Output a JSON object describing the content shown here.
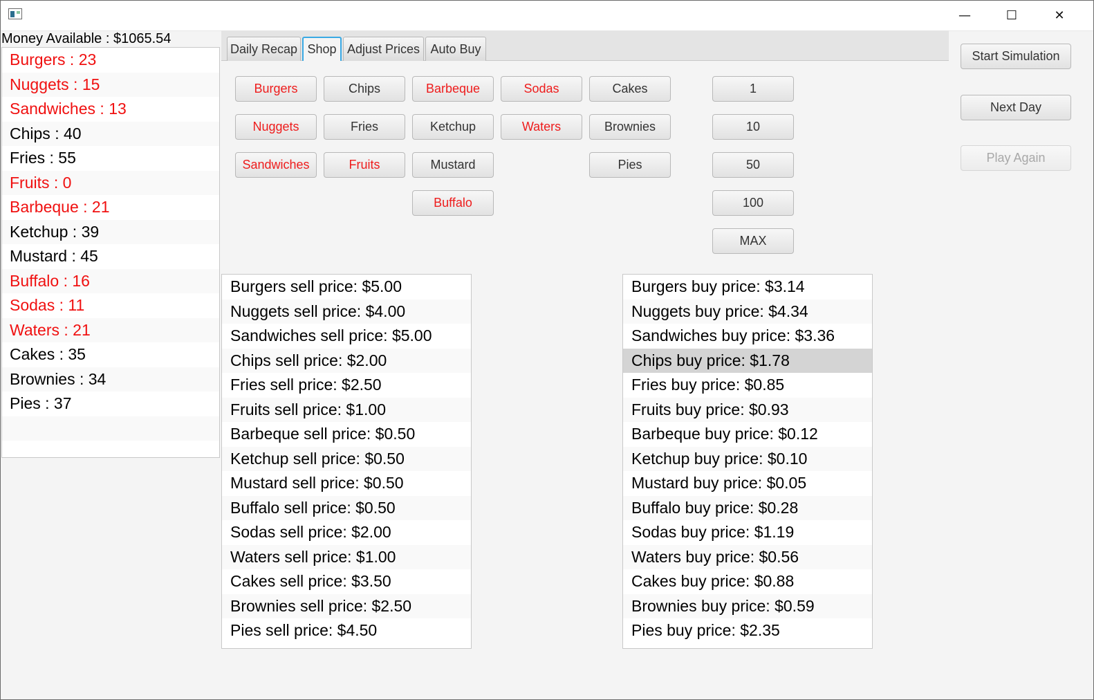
{
  "window": {
    "minimize_glyph": "—",
    "maximize_glyph": "☐",
    "close_glyph": "✕"
  },
  "money": {
    "label": "Money Available : $1065.54"
  },
  "inventory": [
    {
      "text": "Burgers : 23",
      "red": true
    },
    {
      "text": "Nuggets : 15",
      "red": true
    },
    {
      "text": "Sandwiches : 13",
      "red": true
    },
    {
      "text": "Chips : 40",
      "red": false
    },
    {
      "text": "Fries : 55",
      "red": false
    },
    {
      "text": "Fruits : 0",
      "red": true
    },
    {
      "text": "Barbeque : 21",
      "red": true
    },
    {
      "text": "Ketchup : 39",
      "red": false
    },
    {
      "text": "Mustard : 45",
      "red": false
    },
    {
      "text": "Buffalo : 16",
      "red": true
    },
    {
      "text": "Sodas : 11",
      "red": true
    },
    {
      "text": "Waters : 21",
      "red": true
    },
    {
      "text": "Cakes : 35",
      "red": false
    },
    {
      "text": "Brownies : 34",
      "red": false
    },
    {
      "text": "Pies : 37",
      "red": false
    },
    {
      "text": "",
      "red": false
    },
    {
      "text": "",
      "red": false
    }
  ],
  "tabs": [
    {
      "label": "Daily Recap"
    },
    {
      "label": "Shop",
      "active": true
    },
    {
      "label": "Adjust Prices"
    },
    {
      "label": "Auto Buy"
    }
  ],
  "shop_items": [
    {
      "label": "Burgers",
      "red": true
    },
    {
      "label": "Chips",
      "red": false
    },
    {
      "label": "Barbeque",
      "red": true
    },
    {
      "label": "Sodas",
      "red": true
    },
    {
      "label": "Cakes",
      "red": false
    },
    {
      "label": "Nuggets",
      "red": true
    },
    {
      "label": "Fries",
      "red": false
    },
    {
      "label": "Ketchup",
      "red": false
    },
    {
      "label": "Waters",
      "red": true
    },
    {
      "label": "Brownies",
      "red": false
    },
    {
      "label": "Sandwiches",
      "red": true
    },
    {
      "label": "Fruits",
      "red": true
    },
    {
      "label": "Mustard",
      "red": false
    },
    {
      "label": "Pies",
      "red": false
    },
    {
      "label": "Buffalo",
      "red": true
    }
  ],
  "quantities": [
    "1",
    "10",
    "50",
    "100",
    "MAX"
  ],
  "controls": {
    "start_label": "Start Simulation",
    "next_label": "Next Day",
    "play_again_label": "Play Again"
  },
  "sell_prices": [
    "Burgers sell price: $5.00",
    "Nuggets sell price: $4.00",
    "Sandwiches sell price: $5.00",
    "Chips sell price: $2.00",
    "Fries sell price: $2.50",
    "Fruits sell price: $1.00",
    "Barbeque sell price: $0.50",
    "Ketchup sell price: $0.50",
    "Mustard sell price: $0.50",
    "Buffalo sell price: $0.50",
    "Sodas sell price: $2.00",
    "Waters sell price: $1.00",
    "Cakes sell price: $3.50",
    "Brownies sell price: $2.50",
    "Pies sell price: $4.50"
  ],
  "buy_prices": [
    {
      "text": "Burgers buy price: $3.14"
    },
    {
      "text": "Nuggets buy price: $4.34"
    },
    {
      "text": "Sandwiches buy price: $3.36"
    },
    {
      "text": "Chips buy price: $1.78",
      "selected": true
    },
    {
      "text": "Fries buy price: $0.85"
    },
    {
      "text": "Fruits buy price: $0.93"
    },
    {
      "text": "Barbeque buy price: $0.12"
    },
    {
      "text": "Ketchup buy price: $0.10"
    },
    {
      "text": "Mustard buy price: $0.05"
    },
    {
      "text": "Buffalo buy price: $0.28"
    },
    {
      "text": "Sodas buy price: $1.19"
    },
    {
      "text": "Waters buy price: $0.56"
    },
    {
      "text": "Cakes buy price: $0.88"
    },
    {
      "text": "Brownies buy price: $0.59"
    },
    {
      "text": "Pies buy price: $2.35"
    }
  ],
  "colors": {
    "accent": "#39a9e4",
    "alert": "#f01010"
  }
}
